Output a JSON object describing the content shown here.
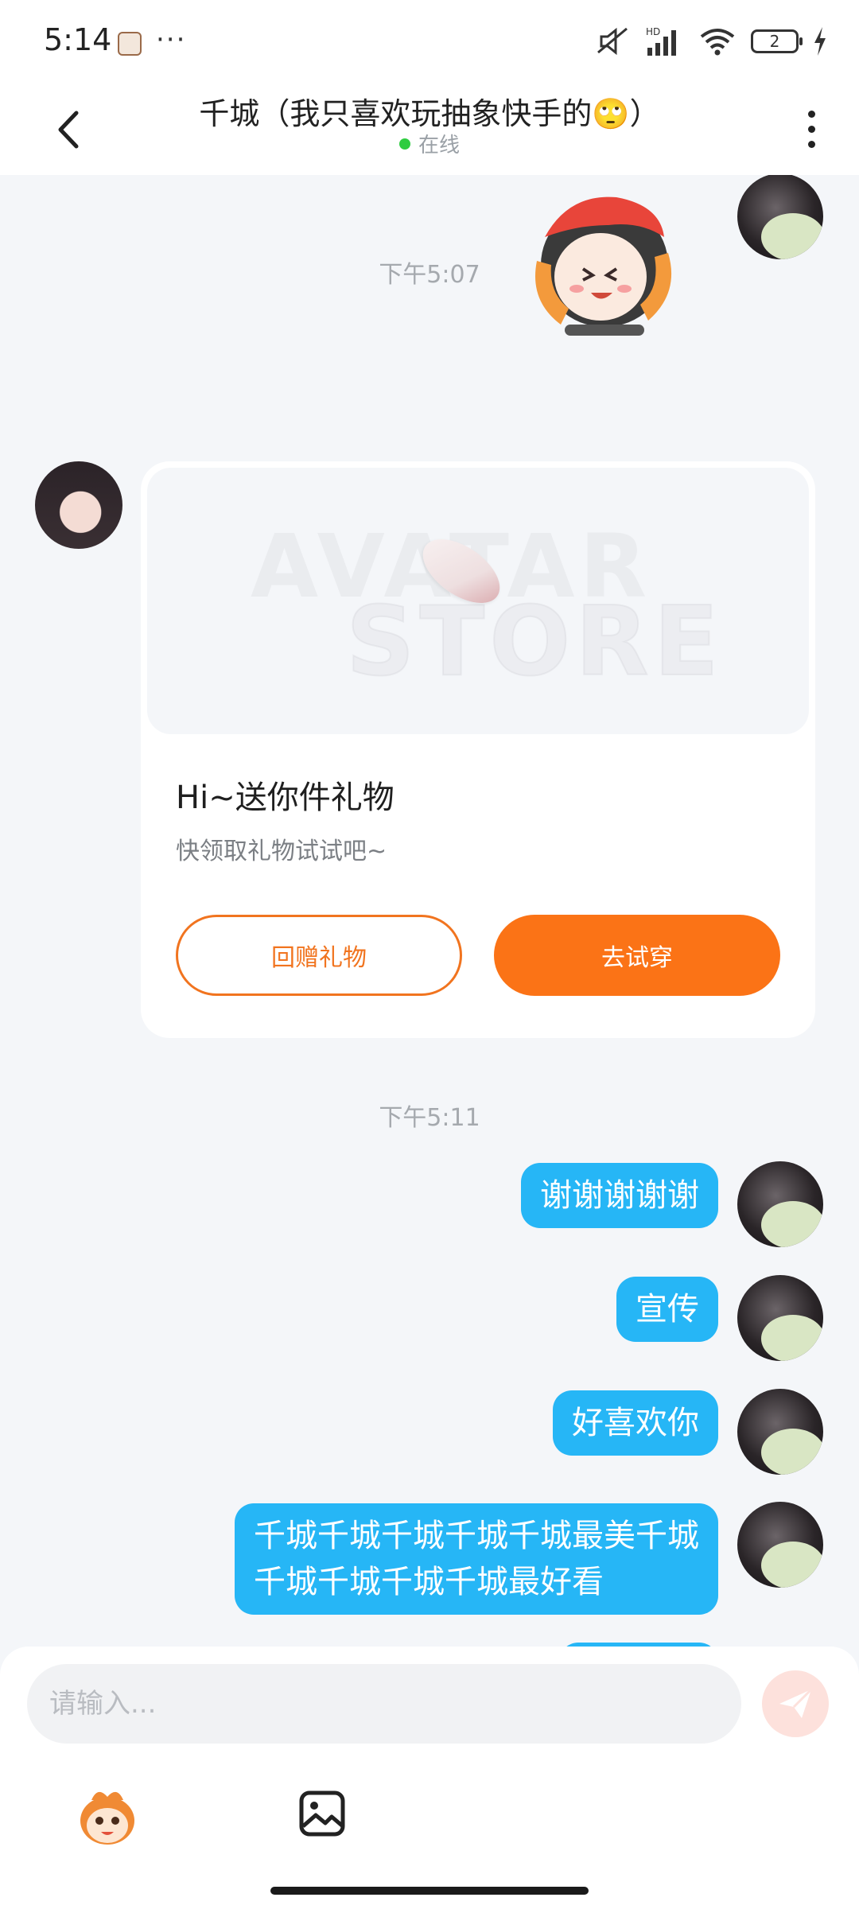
{
  "status_bar": {
    "time": "5:14",
    "more": "···",
    "hd_label": "HD",
    "battery": "2"
  },
  "header": {
    "title": "千城（我只喜欢玩抽象快手的🙄）",
    "status": "在线"
  },
  "messages": {
    "time1": "下午5:07",
    "gift_title": "Hi~送你件礼物",
    "gift_subtitle": "快领取礼物试试吧~",
    "gift_btn_return": "回赠礼物",
    "gift_btn_try": "去试穿",
    "time2": "下午5:11",
    "bubble1": "谢谢谢谢谢",
    "bubble2": "宣传",
    "bubble3": "好喜欢你",
    "bubble4": "千城千城千城千城千城最美千城\n千城千城千城千城最好看"
  },
  "input": {
    "placeholder": "请输入..."
  },
  "colors": {
    "bubble": "#26b6f6",
    "accent": "#fb7316",
    "online": "#2ecc40"
  },
  "icons": [
    "back-arrow-icon",
    "more-vertical-icon",
    "send-icon",
    "emoji-mascot-icon",
    "image-icon",
    "wifi-icon",
    "signal-icon",
    "mute-icon",
    "charging-icon"
  ]
}
